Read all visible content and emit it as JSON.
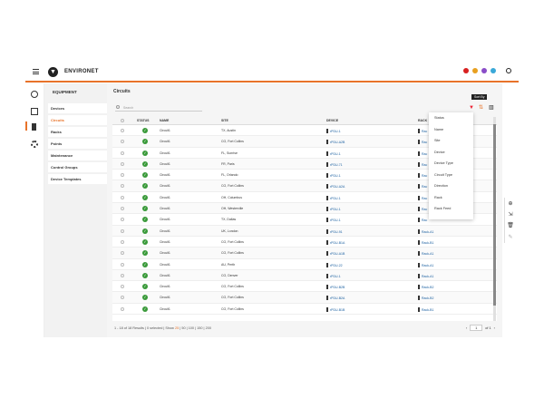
{
  "app": {
    "brand": "ENVIRONET"
  },
  "topbar": {
    "status_colors": [
      "#d82020",
      "#e8a020",
      "#8a4dc8",
      "#3aa8d8"
    ]
  },
  "sidebar": {
    "title": "EQUIPMENT",
    "items": [
      {
        "label": "Devices",
        "active": false
      },
      {
        "label": "Circuits",
        "active": true
      },
      {
        "label": "Racks",
        "active": false
      },
      {
        "label": "Points",
        "active": false
      },
      {
        "label": "Maintenance",
        "active": false
      },
      {
        "label": "Control Groups",
        "active": false
      },
      {
        "label": "Device Templates",
        "active": false
      }
    ]
  },
  "main": {
    "title": "Circuits",
    "search_placeholder": "Search",
    "sort_tooltip": "Sort By"
  },
  "table": {
    "headers": {
      "status": "STATUS",
      "name": "NAME",
      "site": "SITE",
      "device": "DEVICE",
      "rack": "RACK"
    },
    "rows": [
      {
        "name": "Circuit1",
        "site": "TX, Austin",
        "device": "rPDU-1",
        "rack": "Rac"
      },
      {
        "name": "Circuit1",
        "site": "CO, Fort Collins",
        "device": "rPDU-A2B",
        "rack": "Rac"
      },
      {
        "name": "Circuit1",
        "site": "FL, Sunrise",
        "device": "rPDU-1",
        "rack": "Rac"
      },
      {
        "name": "Circuit1",
        "site": "FR, Paris",
        "device": "rPDU-71",
        "rack": "Rac"
      },
      {
        "name": "Circuit1",
        "site": "FL, Orlando",
        "device": "rPDU-1",
        "rack": "Rac"
      },
      {
        "name": "Circuit1",
        "site": "CO, Fort Collins",
        "device": "rPDU-A2A",
        "rack": "Rac"
      },
      {
        "name": "Circuit1",
        "site": "OH, Columbus",
        "device": "rPDU-1",
        "rack": "Rac"
      },
      {
        "name": "Circuit1",
        "site": "OH, Westerville",
        "device": "rPDU-1",
        "rack": "Rac"
      },
      {
        "name": "Circuit1",
        "site": "TX, Dallas",
        "device": "rPDU-1",
        "rack": "Rac"
      },
      {
        "name": "Circuit1",
        "site": "UK, London",
        "device": "rPDU-91",
        "rack": "Rack-A1"
      },
      {
        "name": "Circuit1",
        "site": "CO, Fort Collins",
        "device": "rPDU-B1A",
        "rack": "Rack-B1"
      },
      {
        "name": "Circuit1",
        "site": "CO, Fort Collins",
        "device": "rPDU-A1B",
        "rack": "Rack-A1"
      },
      {
        "name": "Circuit1",
        "site": "AU, Perth",
        "device": "rPDU-22",
        "rack": "Rack-A1"
      },
      {
        "name": "Circuit1",
        "site": "CO, Denver",
        "device": "rPDU-1",
        "rack": "Rack-A1"
      },
      {
        "name": "Circuit1",
        "site": "CO, Fort Collins",
        "device": "rPDU-B2B",
        "rack": "Rack-B2"
      },
      {
        "name": "Circuit1",
        "site": "CO, Fort Collins",
        "device": "rPDU-B2A",
        "rack": "Rack-B2"
      },
      {
        "name": "Circuit1",
        "site": "CO, Fort Collins",
        "device": "rPDU-B1B",
        "rack": "Rack-B1"
      }
    ]
  },
  "footer": {
    "results": "1 - 18 of 18 Results | 0 selected | Show",
    "page_sizes": [
      "25",
      "50",
      "100",
      "150",
      "200"
    ],
    "page_value": "1",
    "page_of": "of 1"
  },
  "sort_menu": {
    "options": [
      "Status",
      "Name",
      "Site",
      "Device",
      "Device Type",
      "Circuit Type",
      "Direction",
      "Rack",
      "Rack Feed"
    ]
  }
}
